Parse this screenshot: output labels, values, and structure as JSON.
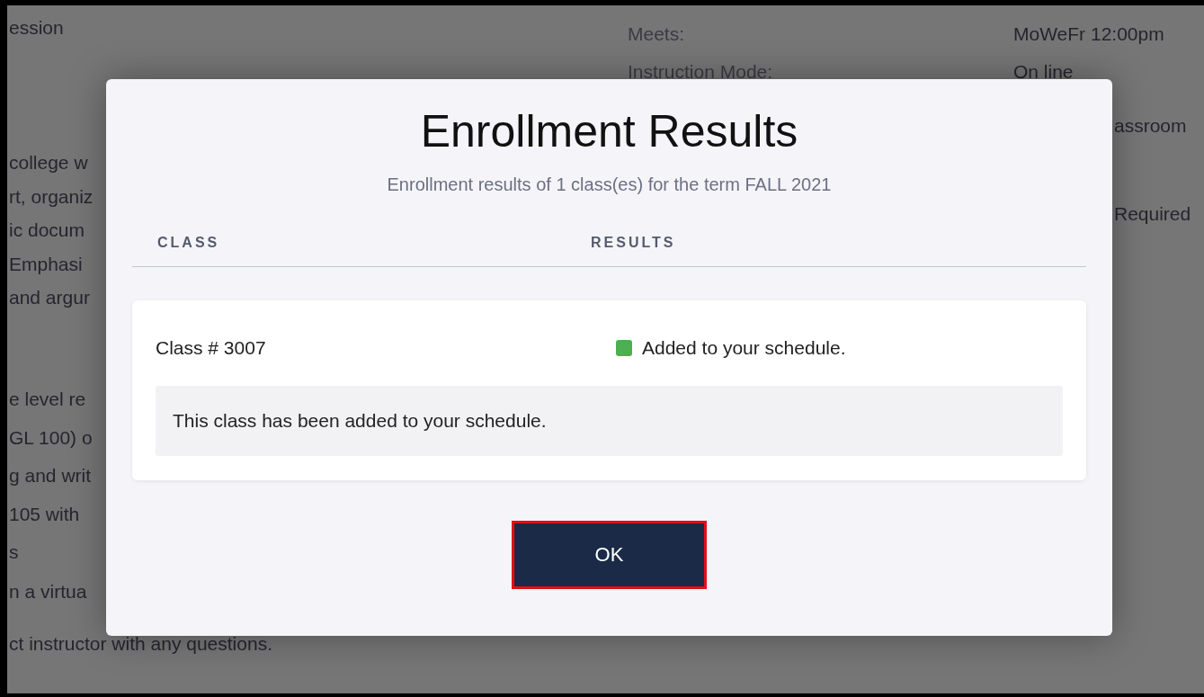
{
  "background": {
    "left_paragraphs": [
      [
        "ession"
      ],
      [
        "college w",
        "rt, organiz",
        "ic docum",
        "Emphasi",
        "and argur"
      ],
      [
        "e level re",
        "GL 100) o",
        "g and writ",
        "105 with",
        "s"
      ],
      [
        "n a virtua",
        "ct instructor with any questions."
      ]
    ],
    "details": [
      {
        "label": "Meets:",
        "value": "MoWeFr 12:00pm"
      },
      {
        "label": "Instruction Mode:",
        "value": "On line"
      }
    ],
    "right_fragments": [
      "assroom",
      "Required"
    ]
  },
  "dialog": {
    "title": "Enrollment Results",
    "subtitle": "Enrollment results of 1 class(es) for the term FALL 2021",
    "columns": [
      "CLASS",
      "RESULTS"
    ],
    "results": [
      {
        "class": "Class # 3007",
        "color": "#4caf50",
        "result": "Added to your schedule.",
        "message": "This class has been added to your schedule."
      }
    ],
    "ok_button": {
      "label": "OK",
      "focused": true
    }
  }
}
